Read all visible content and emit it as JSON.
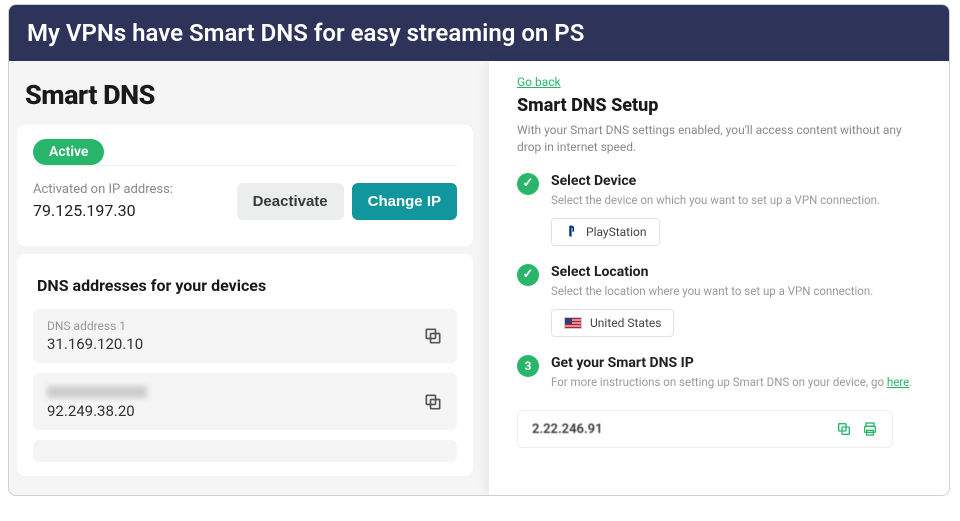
{
  "banner": "My VPNs have Smart DNS for easy streaming on PS",
  "left": {
    "title": "Smart DNS",
    "status_badge": "Active",
    "activated_label": "Activated on IP address:",
    "activated_ip": "79.125.197.30",
    "deactivate": "Deactivate",
    "change_ip": "Change IP",
    "dns_heading": "DNS addresses for your devices",
    "dns": [
      {
        "label": "DNS address 1",
        "value": "31.169.120.10",
        "blurred": false
      },
      {
        "label": "",
        "value": "92.249.38.20",
        "blurred": true
      }
    ]
  },
  "right": {
    "go_back": "Go back",
    "title": "Smart DNS Setup",
    "intro": "With your Smart DNS settings enabled, you'll access content without any drop in internet speed.",
    "steps": [
      {
        "done": true,
        "title": "Select Device",
        "desc": "Select the device on which you want to set up a VPN connection.",
        "chip": "PlayStation"
      },
      {
        "done": true,
        "title": "Select Location",
        "desc": "Select the location where you want to set up a VPN connection.",
        "chip": "United States"
      },
      {
        "done": false,
        "num": "3",
        "title": "Get your Smart DNS IP",
        "desc": "For more instructions on setting up Smart DNS on your device, go ",
        "link": "here",
        "suffix": ".",
        "ip": "2.22.246.91"
      }
    ]
  }
}
